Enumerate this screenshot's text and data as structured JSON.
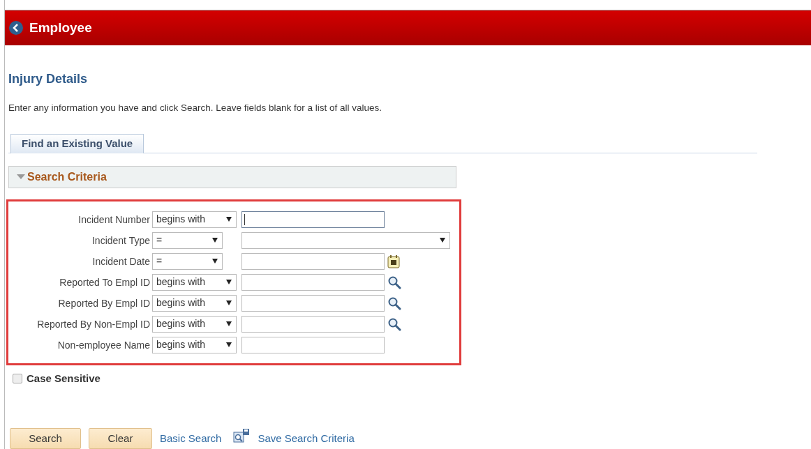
{
  "header": {
    "title": "Employee"
  },
  "page_title": "Injury Details",
  "instructions": "Enter any information you have and click Search. Leave fields blank for a list of all values.",
  "tabs": [
    {
      "label": "Find an Existing Value",
      "selected": true
    }
  ],
  "section": {
    "title": "Search Criteria",
    "expanded": true
  },
  "criteria": [
    {
      "label": "Incident Number",
      "operator": "begins with",
      "kind": "text",
      "focused": true
    },
    {
      "label": "Incident Type",
      "operator": "=",
      "kind": "dropdown",
      "focused": false
    },
    {
      "label": "Incident Date",
      "operator": "=",
      "kind": "date",
      "focused": false
    },
    {
      "label": "Reported To Empl ID",
      "operator": "begins with",
      "kind": "lookup",
      "focused": false
    },
    {
      "label": "Reported By Empl ID",
      "operator": "begins with",
      "kind": "lookup",
      "focused": false
    },
    {
      "label": "Reported By Non-Empl ID",
      "operator": "begins with",
      "kind": "lookup",
      "focused": false
    },
    {
      "label": "Non-employee Name",
      "operator": "begins with",
      "kind": "text",
      "focused": false
    }
  ],
  "case_sensitive": {
    "label": "Case Sensitive",
    "checked": false
  },
  "buttons": [
    "Search",
    "Clear"
  ],
  "links": [
    {
      "label": "Basic Search",
      "kind": "link"
    },
    {
      "label": "Save Search Criteria",
      "kind": "save-link"
    }
  ]
}
